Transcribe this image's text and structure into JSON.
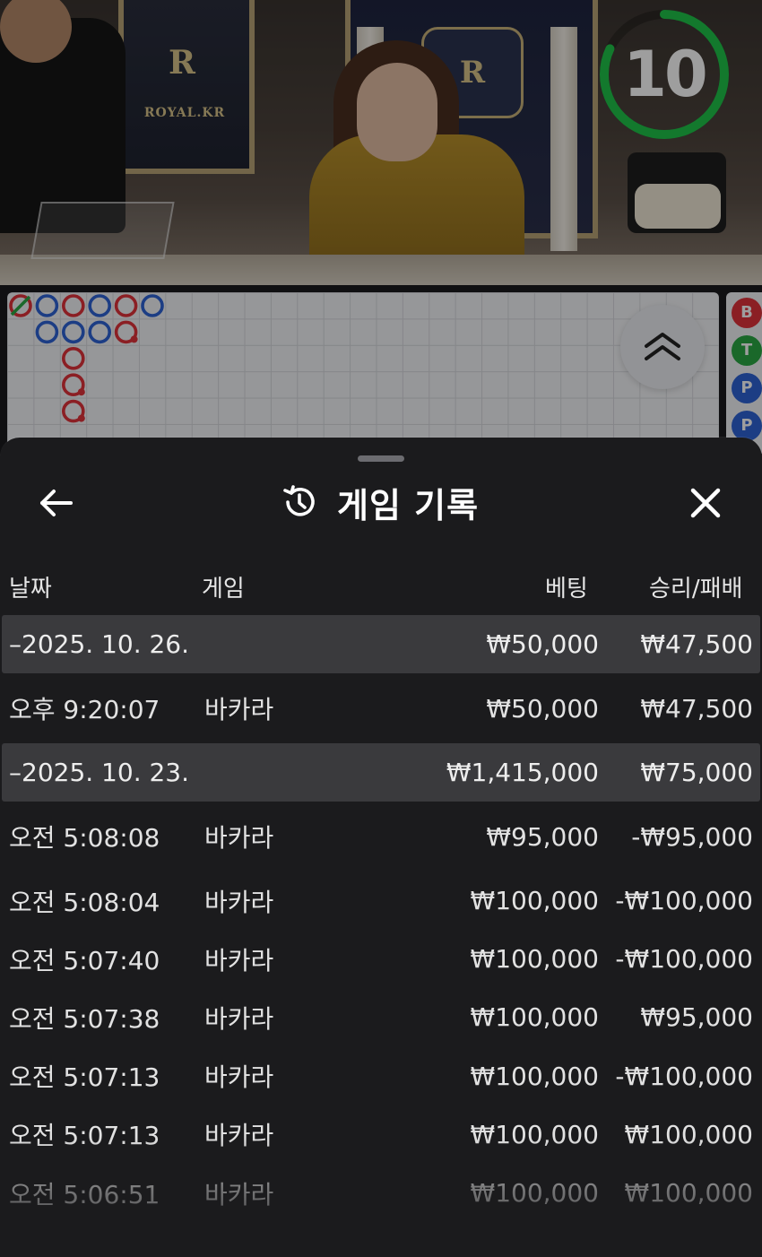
{
  "video": {
    "brand": "ROYAL.KR",
    "crest_letter": "R",
    "countdown": "10",
    "countdown_fraction": 0.82
  },
  "roadmap": {
    "side_labels": [
      "B",
      "T",
      "P",
      "P"
    ],
    "colors": {
      "banker": "#e0323a",
      "player": "#2e63d6",
      "tie": "#2aa845"
    }
  },
  "sheet": {
    "title": "게임 기록",
    "columns": {
      "date": "날짜",
      "game": "게임",
      "bet": "베팅",
      "result": "승리/패배"
    }
  },
  "history": [
    {
      "type": "date",
      "date": "–2025. 10. 26.",
      "bet": "₩50,000",
      "result": "₩47,500"
    },
    {
      "type": "game",
      "time": "오후 9:20:07",
      "game": "바카라",
      "bet": "₩50,000",
      "result": "₩47,500"
    },
    {
      "type": "date",
      "date": "–2025. 10. 23.",
      "bet": "₩1,415,000",
      "result": "₩75,000"
    },
    {
      "type": "game",
      "time": "오전 5:08:08",
      "game": "바카라",
      "bet": "₩95,000",
      "result": "-₩95,000"
    },
    {
      "type": "game",
      "time": "오전 5:08:04",
      "game": "바카라",
      "bet": "₩100,000",
      "result": "-₩100,000"
    },
    {
      "type": "game",
      "time": "오전 5:07:40",
      "game": "바카라",
      "bet": "₩100,000",
      "result": "-₩100,000"
    },
    {
      "type": "game",
      "time": "오전 5:07:38",
      "game": "바카라",
      "bet": "₩100,000",
      "result": "₩95,000"
    },
    {
      "type": "game",
      "time": "오전 5:07:13",
      "game": "바카라",
      "bet": "₩100,000",
      "result": "-₩100,000"
    },
    {
      "type": "game",
      "time": "오전 5:07:13",
      "game": "바카라",
      "bet": "₩100,000",
      "result": "₩100,000"
    },
    {
      "type": "game",
      "time": "오전 5:06:51",
      "game": "바카라",
      "bet": "₩100,000",
      "result": "₩100,000"
    }
  ]
}
